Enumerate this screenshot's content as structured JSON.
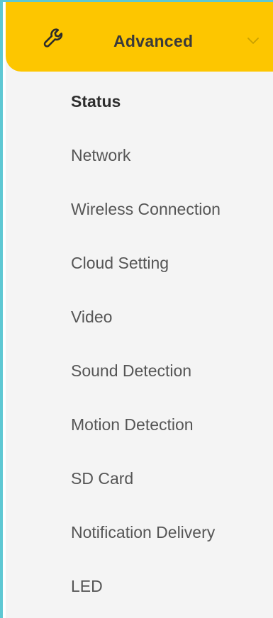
{
  "header": {
    "label": "Advanced",
    "icon": "wrench-icon",
    "expand_icon": "chevron-down-icon",
    "background_color": "#fdc600"
  },
  "menu": {
    "items": [
      {
        "label": "Status",
        "active": true
      },
      {
        "label": "Network",
        "active": false
      },
      {
        "label": "Wireless Connection",
        "active": false
      },
      {
        "label": "Cloud Setting",
        "active": false
      },
      {
        "label": "Video",
        "active": false
      },
      {
        "label": "Sound Detection",
        "active": false
      },
      {
        "label": "Motion Detection",
        "active": false
      },
      {
        "label": "SD Card",
        "active": false
      },
      {
        "label": "Notification Delivery",
        "active": false
      },
      {
        "label": "LED",
        "active": false
      }
    ]
  },
  "colors": {
    "frame_border": "#5ec8d3",
    "sidebar_background": "#f4f4f4",
    "item_text": "#555555",
    "active_text": "#2e2e2e"
  }
}
